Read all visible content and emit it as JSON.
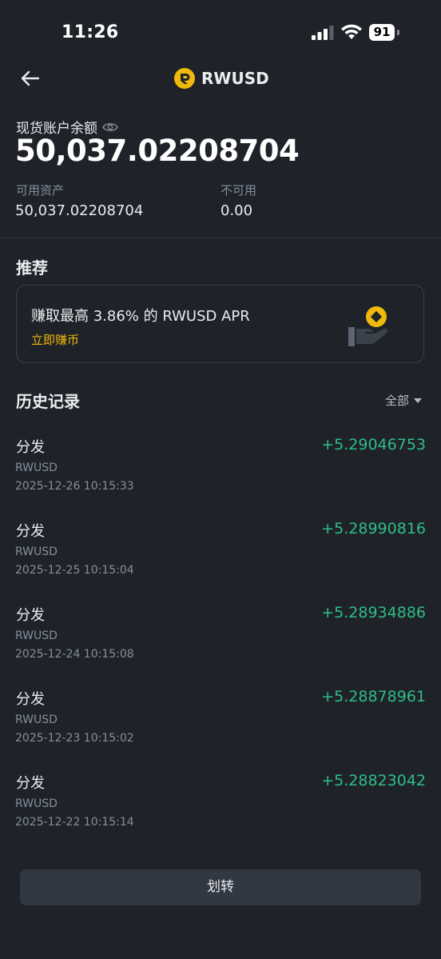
{
  "status_bar": {
    "time": "11:26",
    "battery": "91"
  },
  "header": {
    "title": "RWUSD",
    "icon": "rwusd-coin-icon",
    "back_icon": "arrow-left-icon"
  },
  "balance": {
    "label": "现货账户余额",
    "value": "50,037.02208704",
    "available_label": "可用资产",
    "available_value": "50,037.02208704",
    "unavailable_label": "不可用",
    "unavailable_value": "0.00"
  },
  "recommend": {
    "title": "推荐",
    "promo_text": "赚取最高 3.86% 的 RWUSD APR",
    "promo_link": "立即赚币"
  },
  "history": {
    "title": "历史记录",
    "filter_label": "全部",
    "items": [
      {
        "type": "分发",
        "coin": "RWUSD",
        "time": "2025-12-26 10:15:33",
        "amount": "+5.29046753"
      },
      {
        "type": "分发",
        "coin": "RWUSD",
        "time": "2025-12-25 10:15:04",
        "amount": "+5.28990816"
      },
      {
        "type": "分发",
        "coin": "RWUSD",
        "time": "2025-12-24 10:15:08",
        "amount": "+5.28934886"
      },
      {
        "type": "分发",
        "coin": "RWUSD",
        "time": "2025-12-23 10:15:02",
        "amount": "+5.28878961"
      },
      {
        "type": "分发",
        "coin": "RWUSD",
        "time": "2025-12-22 10:15:14",
        "amount": "+5.28823042"
      }
    ]
  },
  "actions": {
    "transfer_label": "划转"
  },
  "colors": {
    "background": "#1f2329",
    "accent": "#f0b90b",
    "positive": "#2ebd85",
    "muted": "#848e9c",
    "button_bg": "#323843"
  }
}
